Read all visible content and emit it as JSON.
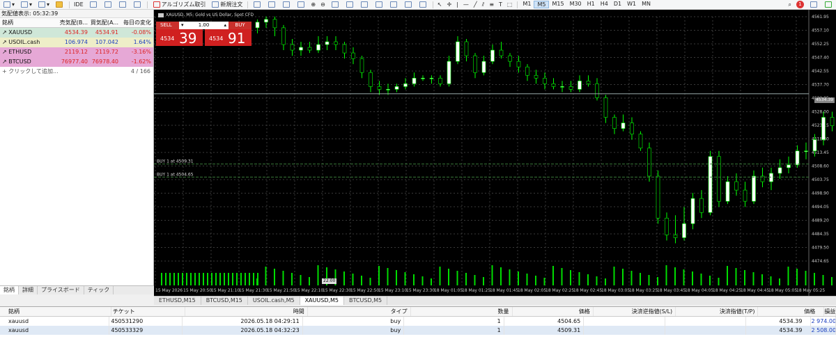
{
  "toolbar": {
    "algo_label": "アルゴリズム取引",
    "new_order_label": "新規注文",
    "ide_label": "IDE",
    "timeframes": [
      "M1",
      "M5",
      "M15",
      "M30",
      "H1",
      "H4",
      "D1",
      "W1",
      "MN"
    ],
    "active_timeframe": "M5",
    "notification_count": "1"
  },
  "market_watch": {
    "title": "気配値表示: 05:32:39",
    "headers": {
      "symbol": "銘柄",
      "bid": "売気配(B...",
      "ask": "買気配(A...",
      "change": "毎日の変化"
    },
    "rows": [
      {
        "symbol": "XAUUSD",
        "bid": "4534.39",
        "ask": "4534.91",
        "change": "-0.08%",
        "bg": "#cfe7d8",
        "dir": "neg"
      },
      {
        "symbol": "USOIL.cash",
        "bid": "106.974",
        "ask": "107.042",
        "change": "1.64%",
        "bg": "#eeeec8",
        "dir": "pos"
      },
      {
        "symbol": "ETHUSD",
        "bid": "2119.12",
        "ask": "2119.72",
        "change": "-3.16%",
        "bg": "#e6a8d6",
        "dir": "neg"
      },
      {
        "symbol": "BTCUSD",
        "bid": "76977.40",
        "ask": "76978.40",
        "change": "-1.62%",
        "bg": "#e6a8d6",
        "dir": "neg"
      }
    ],
    "add_label": "クリックして追加...",
    "count": "4 / 166",
    "tabs": [
      "銘柄",
      "詳細",
      "プライスボード",
      "ティック"
    ]
  },
  "chart": {
    "title": "XAUUSD, M5:  Gold vs US Dollar, Spot CFD",
    "sell_label": "SELL",
    "buy_label": "BUY",
    "lot": "1.00",
    "sell_small": "4534",
    "sell_big": "39",
    "buy_small": "4534",
    "buy_big": "91",
    "order_lines": [
      "BUY 1 at 4509.31",
      "BUY 1 at 4504.65"
    ],
    "current_price": "4534.39",
    "time_tag": "22:00",
    "price_labels": [
      "4561.95",
      "4557.10",
      "4552.25",
      "4547.40",
      "4542.55",
      "4537.70",
      "4532.85",
      "4528.00",
      "4523.15",
      "4518.30",
      "4513.45",
      "4508.60",
      "4503.75",
      "4498.90",
      "4494.05",
      "4489.20",
      "4484.35",
      "4479.50",
      "4474.65"
    ],
    "time_labels": [
      "15 May 2026",
      "15 May 20:50",
      "15 May 21:10",
      "15 May 21:30",
      "15 May 21:50",
      "15 May 22:10",
      "15 May 22:30",
      "15 May 22:50",
      "15 May 23:10",
      "15 May 23:30",
      "18 May 01:05",
      "18 May 01:25",
      "18 May 01:45",
      "18 May 02:05",
      "18 May 02:25",
      "18 May 02:45",
      "18 May 03:05",
      "18 May 03:25",
      "18 May 03:45",
      "18 May 04:05",
      "18 May 04:25",
      "18 May 04:45",
      "18 May 05:05",
      "18 May 05:25"
    ],
    "colors": {
      "bull": "#ffffff",
      "bear": "#000000",
      "wick": "#00ff00",
      "grid": "#3a3a3a",
      "volume": "#00dd00"
    }
  },
  "chart_tabs": [
    "ETHUSD,M15",
    "BTCUSD,M15",
    "USOIL.cash,M5",
    "XAUUSD,M5",
    "BTCUSD,M5"
  ],
  "active_chart_tab": "XAUUSD,M5",
  "trades": {
    "headers": [
      "銘柄",
      "チケット",
      "時間",
      "タイプ",
      "数量",
      "価格",
      "決済逆指値(S/L)",
      "決済指値(T/P)",
      "価格",
      "損益"
    ],
    "rows": [
      [
        "xauusd",
        "450531290",
        "2026.05.18 04:29:11",
        "buy",
        "1",
        "4504.65",
        "",
        "",
        "4534.39",
        "2 974.00"
      ],
      [
        "xauusd",
        "450533329",
        "2026.05.18 04:32:23",
        "buy",
        "1",
        "4509.31",
        "",
        "",
        "4534.39",
        "2 508.00"
      ]
    ]
  }
}
